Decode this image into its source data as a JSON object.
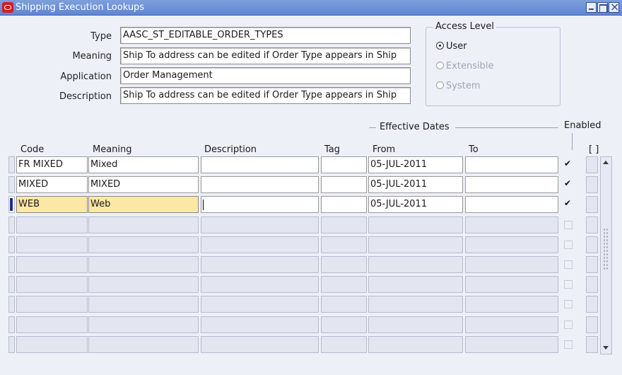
{
  "window": {
    "title": "Shipping Execution Lookups"
  },
  "header": {
    "type_label": "Type",
    "type_value": "AASC_ST_EDITABLE_ORDER_TYPES",
    "meaning_label": "Meaning",
    "meaning_value": "Ship To address can be edited if Order Type appears in Ship",
    "application_label": "Application",
    "application_value": "Order Management",
    "description_label": "Description",
    "description_value": "Ship To address can be edited if Order Type appears in Ship"
  },
  "access_level": {
    "legend": "Access Level",
    "options": [
      "User",
      "Extensible",
      "System"
    ],
    "selected": "User"
  },
  "grid": {
    "effective_dates_label": "Effective Dates",
    "enabled_label": "Enabled",
    "dff_label": "[ ]",
    "columns": {
      "code": "Code",
      "meaning": "Meaning",
      "description": "Description",
      "tag": "Tag",
      "from": "From",
      "to": "To"
    },
    "rows": [
      {
        "code": "FR MIXED",
        "meaning": "Mixed",
        "description": "",
        "tag": "",
        "from": "05-JUL-2011",
        "to": "",
        "enabled": true
      },
      {
        "code": "MIXED",
        "meaning": "MIXED",
        "description": "",
        "tag": "",
        "from": "05-JUL-2011",
        "to": "",
        "enabled": true
      },
      {
        "code": "WEB",
        "meaning": "Web",
        "description": "",
        "tag": "",
        "from": "05-JUL-2011",
        "to": "",
        "enabled": true
      }
    ],
    "empty_rows": 7
  },
  "colors": {
    "titlebar": "#6b8fd8",
    "background": "#eef0f8",
    "current_record": "#fbe7a6",
    "record_indicator": "#1c2f8c"
  }
}
